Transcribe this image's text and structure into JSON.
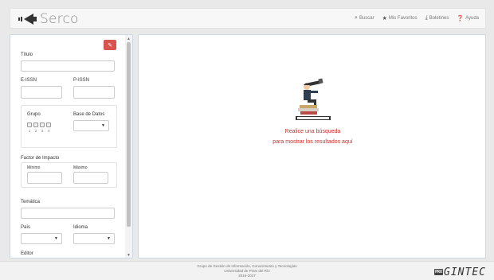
{
  "header": {
    "brand": "Serco",
    "nav": [
      {
        "label": "Buscar",
        "icon": "search-icon"
      },
      {
        "label": "Mis Favoritos",
        "icon": "star-icon"
      },
      {
        "label": "Boletines",
        "icon": "download-icon"
      },
      {
        "label": "Ayuda",
        "icon": "help-icon"
      }
    ]
  },
  "filters": {
    "titulo_label": "Título",
    "titulo_value": "",
    "eissn_label": "E-ISSN",
    "pissn_label": "P-ISSN",
    "grupo_label": "Grupo",
    "grupo_numbers": [
      "1",
      "2",
      "3",
      "4"
    ],
    "base_datos_label": "Base de Datos",
    "factor_label": "Factor de Impacto",
    "minimo_label": "Mínimo",
    "maximo_label": "Máximo",
    "tematica_label": "Temática",
    "pais_label": "País",
    "idioma_label": "Idioma",
    "editor_label": "Editor"
  },
  "main": {
    "message_line1": "Realice una búsqueda",
    "message_line2": "para mostrar los resultados aquí"
  },
  "footer": {
    "line1": "Grupo de Gestión de Información, Conocimiento y Tecnologías",
    "line2": "Universidad de Pinar del Río",
    "line3": "2016-2017",
    "logo_prefix": "PRO",
    "logo_word": "GINTEC"
  },
  "colors": {
    "danger": "#d9534f",
    "message": "#c9302c"
  }
}
